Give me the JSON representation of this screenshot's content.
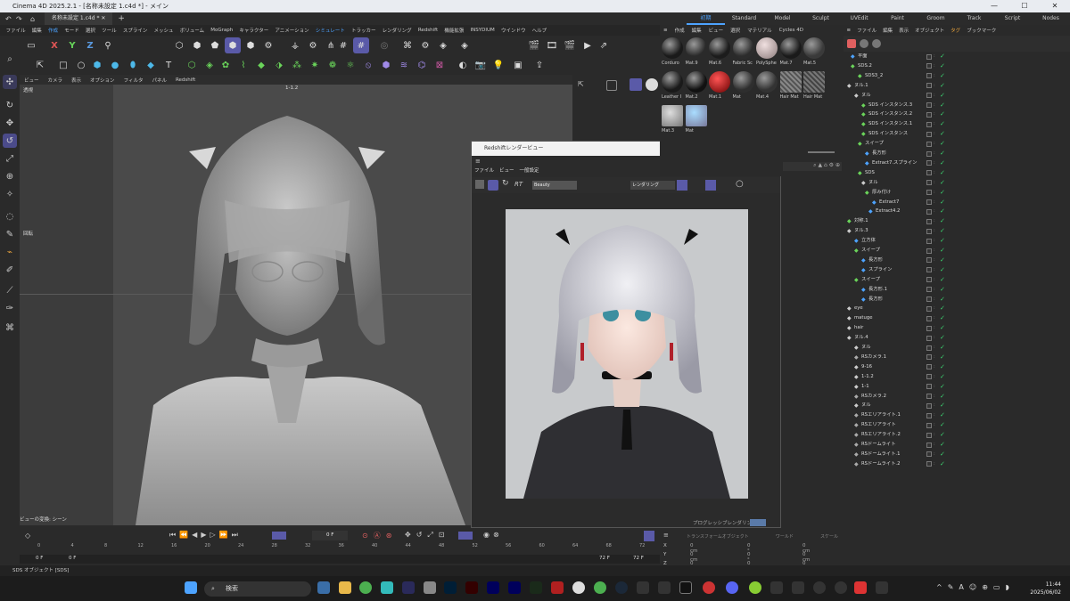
{
  "window": {
    "title": "Cinema 4D 2025.2.1 - [名称未設定 1.c4d *] - メイン"
  },
  "tabs": {
    "doc": "名称未設定 1.c4d *",
    "layouts": [
      "初期",
      "Standard",
      "Model",
      "Sculpt",
      "UVEdit",
      "Paint",
      "Groom",
      "Track",
      "Script",
      "Nodes"
    ]
  },
  "menu": [
    "ファイル",
    "編集",
    "作成",
    "モード",
    "選択",
    "ツール",
    "スプライン",
    "メッシュ",
    "ボリューム",
    "MoGraph",
    "キャラクター",
    "アニメーション",
    "シミュレート",
    "トラッカー",
    "レンダリング",
    "Redshift",
    "機能拡張",
    "INSYDIUM",
    "ウインドウ",
    "ヘルプ"
  ],
  "viewport": {
    "menu": [
      "ビュー",
      "カメラ",
      "表示",
      "オプション",
      "フィルタ",
      "パネル",
      "Redshift"
    ],
    "label": "透視",
    "camera": "1-1.2",
    "rotate_label": "回転",
    "bottom_label": "ビューの変換: シーン"
  },
  "render_window": {
    "title": "Redshiftレンダービュー",
    "menu": [
      "ファイル",
      "ビュー",
      "一般設定"
    ],
    "aov": "Beauty",
    "mode": "レンダリング",
    "rt": "RT",
    "status": "プログレッシブレンダリング"
  },
  "material_panel": {
    "menu": [
      "作成",
      "編集",
      "ビュー",
      "選択",
      "マテリアル",
      "Cycles 4D"
    ],
    "materials": [
      "Corduro",
      "Mat.9",
      "Mat.6",
      "Fabric Sc",
      "PolySphe",
      "Mat.7",
      "Mat.5",
      "Leather I",
      "Mat.2",
      "Mat.1",
      "Mat",
      "Mat.4",
      "Hair Mat",
      "Hair Mat",
      "Mat.3",
      "Mat"
    ]
  },
  "object_panel": {
    "menu": [
      "ファイル",
      "編集",
      "表示",
      "オブジェクト",
      "タグ",
      "ブックマーク"
    ],
    "objects": [
      "平面",
      "SDS.2",
      "SDS3_2",
      "ヌル.1",
      "ヌル",
      "SDS インスタンス.3",
      "SDS インスタンス.2",
      "SDS インスタンス.1",
      "SDS インスタンス",
      "スイープ",
      "長方形",
      "Extract7.スプライン",
      "SDS",
      "ヌル",
      "厚み付け",
      "Extract7",
      "Extract4.2",
      "対称.1",
      "ヌル.3",
      "立方体",
      "スイープ",
      "長方形",
      "スプライン",
      "スイープ",
      "長方形.1",
      "長方形",
      "eye",
      "matuge",
      "hair",
      "ヌル.4",
      "ヌル",
      "RSカメラ.1",
      "9-16",
      "1-1.2",
      "1-1",
      "RSカメラ.2",
      "ヌル",
      "RSエリアライト.1",
      "RSエリアライト",
      "RSエリアライト.2",
      "RSドームライト",
      "RSドームライト.1",
      "RSドームライト.2"
    ]
  },
  "timeline": {
    "frame": "0 F",
    "start": "0 F",
    "start2": "0 F",
    "end": "72 F",
    "end2": "72 F",
    "ticks": [
      "0",
      "4",
      "8",
      "12",
      "16",
      "20",
      "24",
      "28",
      "32",
      "36",
      "40",
      "44",
      "48",
      "52",
      "56",
      "60",
      "64",
      "68",
      "72"
    ]
  },
  "coords": {
    "headers": [
      "トランスフォームオブジェクト",
      "ワールド",
      "スケール"
    ],
    "rows": [
      {
        "axis": "X",
        "p": "0 cm",
        "r": "0 °",
        "s": "0 cm"
      },
      {
        "axis": "Y",
        "p": "0 cm",
        "r": "0 °",
        "s": "0 cm"
      },
      {
        "axis": "Z",
        "p": "0 cm",
        "r": "0 °",
        "s": "0 cm"
      }
    ]
  },
  "status": "SDS オブジェクト [SDS]",
  "taskbar": {
    "search": "検索",
    "time": "11:44",
    "date": "2025/06/02"
  },
  "colors": {
    "accent": "#4da3ff",
    "active_tab": "#e6a23c",
    "check": "#3bd16f"
  }
}
